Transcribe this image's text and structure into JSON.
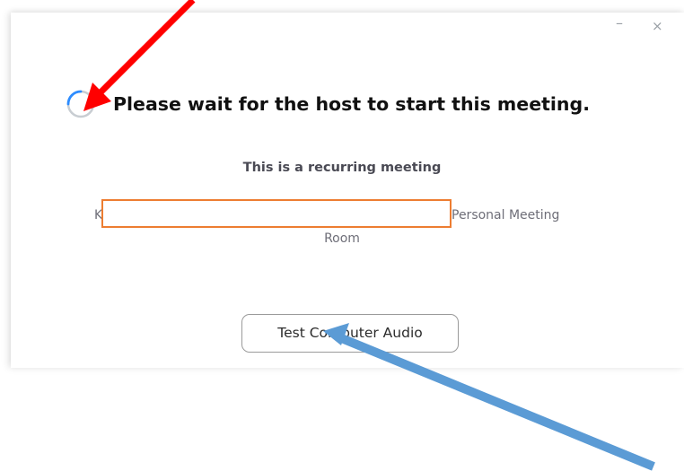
{
  "window": {
    "minimize_symbol": "–",
    "close_symbol": "×"
  },
  "status": {
    "title": "Please wait for the host to start this meeting.",
    "spinner_icon": "loading-spinner-icon"
  },
  "meeting": {
    "recurring_label": "This is a recurring meeting",
    "name_prefix": "K",
    "name_suffix": "Personal Meeting",
    "name_suffix_line2": "Room"
  },
  "actions": {
    "test_audio_label": "Test Computer Audio"
  },
  "annotations": {
    "red_arrow_color": "#ff0000",
    "blue_arrow_color": "#5b9bd5",
    "redaction_border_color": "#ed7d31"
  }
}
